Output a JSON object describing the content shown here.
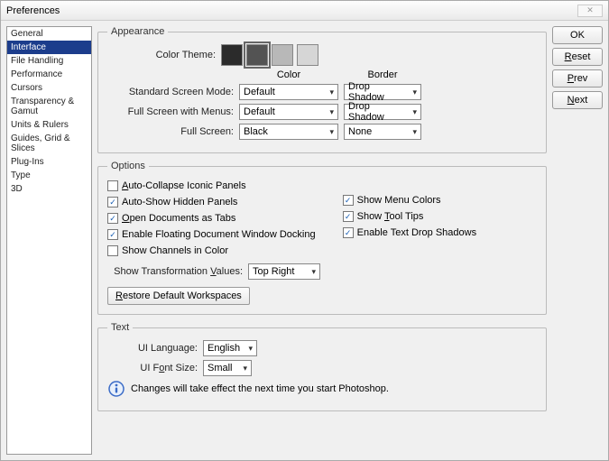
{
  "title": "Preferences",
  "sidebar": {
    "items": [
      {
        "label": "General"
      },
      {
        "label": "Interface"
      },
      {
        "label": "File Handling"
      },
      {
        "label": "Performance"
      },
      {
        "label": "Cursors"
      },
      {
        "label": "Transparency & Gamut"
      },
      {
        "label": "Units & Rulers"
      },
      {
        "label": "Guides, Grid & Slices"
      },
      {
        "label": "Plug-Ins"
      },
      {
        "label": "Type"
      },
      {
        "label": "3D"
      }
    ],
    "selected_index": 1
  },
  "buttons": {
    "ok": "OK",
    "reset": "Reset",
    "prev": "Prev",
    "next": "Next"
  },
  "appearance": {
    "legend": "Appearance",
    "color_theme_label": "Color Theme:",
    "swatches": [
      "#2b2b2b",
      "#535353",
      "#b8b8b8",
      "#d6d6d6"
    ],
    "selected_swatch": 1,
    "header_color": "Color",
    "header_border": "Border",
    "rows": [
      {
        "label": "Standard Screen Mode:",
        "color": "Default",
        "border": "Drop Shadow"
      },
      {
        "label": "Full Screen with Menus:",
        "color": "Default",
        "border": "Drop Shadow"
      },
      {
        "label": "Full Screen:",
        "color": "Black",
        "border": "None"
      }
    ]
  },
  "options": {
    "legend": "Options",
    "left": [
      {
        "label": "Auto-Collapse Iconic Panels",
        "checked": false,
        "u": 0
      },
      {
        "label": "Auto-Show Hidden Panels",
        "checked": true,
        "u": -1
      },
      {
        "label": "Open Documents as Tabs",
        "checked": true,
        "u": 0
      },
      {
        "label": "Enable Floating Document Window Docking",
        "checked": true,
        "u": -1
      },
      {
        "label": "Show Channels in Color",
        "checked": false,
        "u": -1
      }
    ],
    "right": [
      {
        "label": "Show Menu Colors",
        "checked": true,
        "u": -1
      },
      {
        "label": "Show Tool Tips",
        "checked": true,
        "u": 5
      },
      {
        "label": "Enable Text Drop Shadows",
        "checked": true,
        "u": -1
      }
    ],
    "transform_label": "Show Transformation Values:",
    "transform_value": "Top Right",
    "restore": "Restore Default Workspaces"
  },
  "text": {
    "legend": "Text",
    "lang_label": "UI Language:",
    "lang_value": "English",
    "font_label": "UI Font Size:",
    "font_value": "Small",
    "note": "Changes will take effect the next time you start Photoshop."
  }
}
